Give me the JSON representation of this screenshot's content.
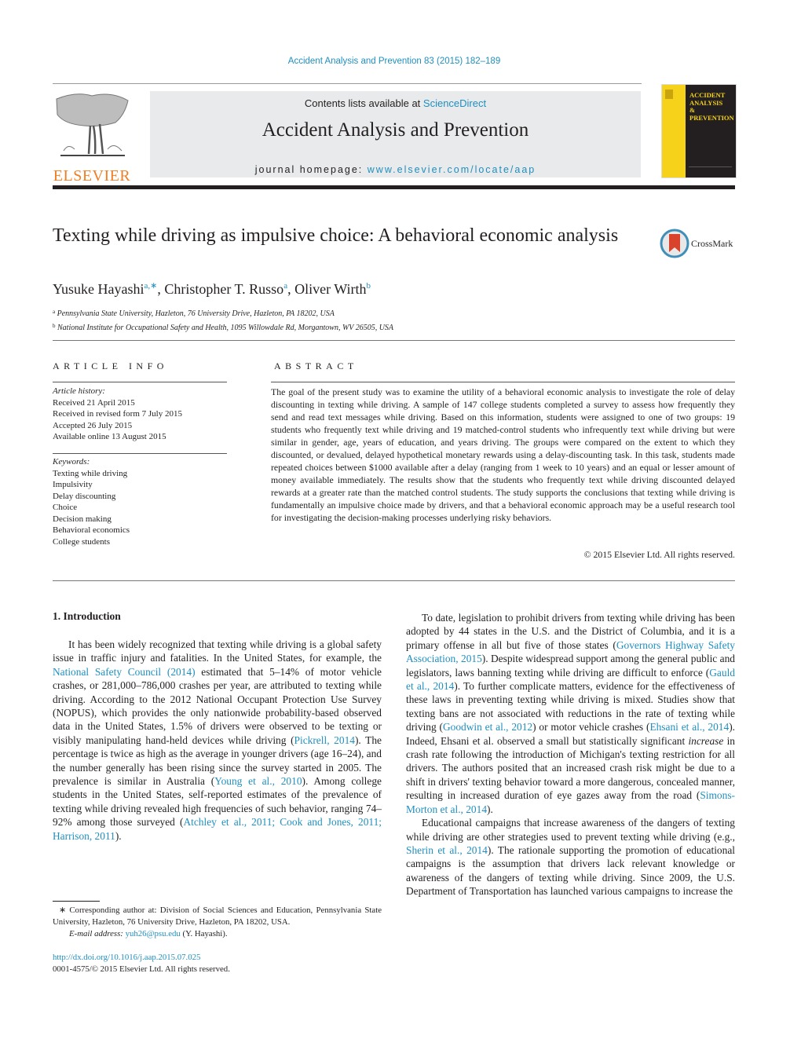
{
  "header": {
    "journal_reference": "Accident Analysis and Prevention 83 (2015) 182–189",
    "contents_prefix": "Contents lists available at ",
    "contents_link": "ScienceDirect",
    "journal_title": "Accident Analysis and Prevention",
    "homepage_prefix": "journal homepage: ",
    "homepage_link": "www.elsevier.com/locate/aap",
    "publisher_logo_text": "ELSEVIER",
    "cover_title_lines": [
      "ACCIDENT",
      "ANALYSIS",
      "&",
      "PREVENTION"
    ],
    "crossmark_label": "CrossMark"
  },
  "article": {
    "title": "Texting while driving as impulsive choice: A behavioral economic analysis",
    "authors": [
      {
        "name": "Yusuke Hayashi",
        "sup": "a,∗",
        "sep": ", "
      },
      {
        "name": "Christopher T. Russo",
        "sup": "a",
        "sep": ", "
      },
      {
        "name": "Oliver Wirth",
        "sup": "b",
        "sep": ""
      }
    ],
    "affiliations": [
      {
        "mark": "a",
        "text": "Pennsylvania State University, Hazleton, 76 University Drive, Hazleton, PA 18202, USA"
      },
      {
        "mark": "b",
        "text": "National Institute for Occupational Safety and Health, 1095 Willowdale Rd, Morgantown, WV 26505, USA"
      }
    ]
  },
  "article_info": {
    "heading": "ARTICLE INFO",
    "history_label": "Article history:",
    "history": [
      "Received 21 April 2015",
      "Received in revised form 7 July 2015",
      "Accepted 26 July 2015",
      "Available online 13 August 2015"
    ],
    "keywords_label": "Keywords:",
    "keywords": [
      "Texting while driving",
      "Impulsivity",
      "Delay discounting",
      "Choice",
      "Decision making",
      "Behavioral economics",
      "College students"
    ]
  },
  "abstract": {
    "heading": "ABSTRACT",
    "text": "The goal of the present study was to examine the utility of a behavioral economic analysis to investigate the role of delay discounting in texting while driving. A sample of 147 college students completed a survey to assess how frequently they send and read text messages while driving. Based on this information, students were assigned to one of two groups: 19 students who frequently text while driving and 19 matched-control students who infrequently text while driving but were similar in gender, age, years of education, and years driving. The groups were compared on the extent to which they discounted, or devalued, delayed hypothetical monetary rewards using a delay-discounting task. In this task, students made repeated choices between $1000 available after a delay (ranging from 1 week to 10 years) and an equal or lesser amount of money available immediately. The results show that the students who frequently text while driving discounted delayed rewards at a greater rate than the matched control students. The study supports the conclusions that texting while driving is fundamentally an impulsive choice made by drivers, and that a behavioral economic approach may be a useful research tool for investigating the decision-making processes underlying risky behaviors.",
    "copyright": "© 2015 Elsevier Ltd. All rights reserved."
  },
  "body": {
    "section_title": "1.  Introduction",
    "left_paragraph": [
      {
        "t": "It has been widely recognized that texting while driving is a global safety issue in traffic injury and fatalities. In the United States, for example, the "
      },
      {
        "link": "National Safety Council (2014)"
      },
      {
        "t": " estimated that 5–14% of motor vehicle crashes, or 281,000–786,000 crashes per year, are attributed to texting while driving. According to the 2012 National Occupant Protection Use Survey (NOPUS), which provides the only nationwide probability-based observed data in the United States, 1.5% of drivers were observed to be texting or visibly manipulating hand-held devices while driving ("
      },
      {
        "link": "Pickrell, 2014"
      },
      {
        "t": "). The percentage is twice as high as the average in younger drivers (age 16–24), and the number generally has been rising since the survey started in 2005. The prevalence is similar in Australia ("
      },
      {
        "link": "Young et al., 2010"
      },
      {
        "t": "). Among college students in the United States, self-reported estimates of the prevalence of texting while driving revealed high frequencies of such behavior, ranging 74–92% among those surveyed ("
      },
      {
        "link": "Atchley et al., 2011; Cook and Jones, 2011; Harrison, 2011"
      },
      {
        "t": ")."
      }
    ],
    "right_paragraph_1": [
      {
        "t": "To date, legislation to prohibit drivers from texting while driving has been adopted by 44 states in the U.S. and the District of Columbia, and it is a primary offense in all but five of those states ("
      },
      {
        "link": "Governors Highway Safety Association, 2015"
      },
      {
        "t": "). Despite widespread support among the general public and legislators, laws banning texting while driving are difficult to enforce ("
      },
      {
        "link": "Gauld et al., 2014"
      },
      {
        "t": "). To further complicate matters, evidence for the effectiveness of these laws in preventing texting while driving is mixed. Studies show that texting bans are not associated with reductions in the rate of texting while driving ("
      },
      {
        "link": "Goodwin et al., 2012"
      },
      {
        "t": ") or motor vehicle crashes ("
      },
      {
        "link": "Ehsani et al., 2014"
      },
      {
        "t": "). Indeed, Ehsani et al. observed a small but statistically significant "
      },
      {
        "em": "increase"
      },
      {
        "t": " in crash rate following the introduction of Michigan's texting restriction for all drivers. The authors posited that an increased crash risk might be due to a shift in drivers' texting behavior toward a more dangerous, concealed manner, resulting in increased duration of eye gazes away from the road ("
      },
      {
        "link": "Simons-Morton et al., 2014"
      },
      {
        "t": ")."
      }
    ],
    "right_paragraph_2": [
      {
        "t": "Educational campaigns that increase awareness of the dangers of texting while driving are other strategies used to prevent texting while driving (e.g., "
      },
      {
        "link": "Sherin et al., 2014"
      },
      {
        "t": "). The rationale supporting the promotion of educational campaigns is the assumption that drivers lack relevant knowledge or awareness of the dangers of texting while driving. Since 2009, the U.S. Department of Transportation has launched various campaigns to increase the"
      }
    ]
  },
  "footnote": {
    "corresponding": "∗  Corresponding author at: Division of Social Sciences and Education, Pennsylvania State University, Hazleton, 76 University Drive, Hazleton, PA 18202, USA.",
    "email_label": "E-mail address: ",
    "email": "yuh26@psu.edu",
    "email_suffix": " (Y. Hayashi).",
    "doi": "http://dx.doi.org/10.1016/j.aap.2015.07.025",
    "issn_line": "0001-4575/© 2015 Elsevier Ltd. All rights reserved."
  },
  "colors": {
    "link": "#1f8fbf",
    "elsevier_orange": "#f07e26",
    "cover_yellow": "#f6d21a",
    "masthead_gray": "#e9eaeb"
  }
}
